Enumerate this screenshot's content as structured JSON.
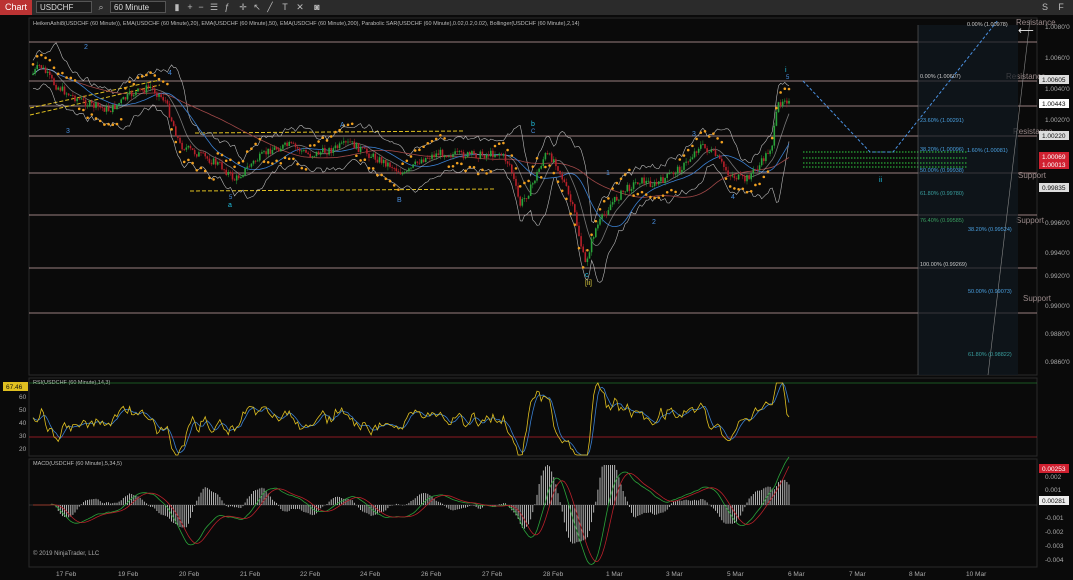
{
  "toolbar": {
    "tab_label": "Chart",
    "instrument": "USDCHF",
    "timeframe": "60 Minute"
  },
  "price_panel": {
    "indicators_title": "HeikenAshi8(USDCHF (60 Minute)), EMA(USDCHF (60 Minute),20), EMA(USDCHF (60 Minute),50), EMA(USDCHF (60 Minute),200), Parabolic SAR(USDCHF (60 Minute),0.02,0.2,0.02), Bollinger(USDCHF (60 Minute),2,14)",
    "price_ticks": [
      "1.0080'0",
      "1.0060'0",
      "1.0040'0",
      "1.0020'0",
      "0.9960'0",
      "0.9940'0",
      "0.9920'0",
      "0.9900'0",
      "0.9880'0",
      "0.9860'0"
    ],
    "price_badges": [
      {
        "text": "1.00605",
        "kind": "level"
      },
      {
        "text": "1.00443",
        "kind": "current"
      },
      {
        "text": "1.00220",
        "kind": "level"
      },
      {
        "text": "1.00069",
        "kind": "red"
      },
      {
        "text": "1.00013",
        "kind": "red"
      },
      {
        "text": "0.99835",
        "kind": "level"
      }
    ],
    "h_labels": [
      "Resistance",
      "Resistance",
      "Resistance",
      "Support",
      "Support",
      "Support"
    ],
    "fib_labels": [
      "0.00% (1.00978)",
      "0.00% (1.00607)",
      "23.60% (1.00291)",
      "38.20% (1.00096)",
      "50.00% (0.99938)",
      "61.80% (0.99780)",
      "76.40% (0.99585)",
      "100.00% (0.99269)",
      "1.60% (1.00081)",
      "38.20% (0.99524)",
      "50.00% (0.99073)",
      "61.80% (0.98822)"
    ],
    "wave_labels": [
      "2",
      "3",
      "4",
      "a",
      "5",
      "A",
      "B",
      "b",
      "C",
      "c",
      "[ii]",
      "1",
      "2",
      "3",
      "4",
      "5",
      "i",
      "ii"
    ],
    "copyright": "© 2019 NinjaTrader, LLC"
  },
  "rsi_panel": {
    "title": "RSI(USDCHF (60 Minute),14,3)",
    "current": "67.46",
    "ticks": [
      "60",
      "50",
      "40",
      "30",
      "20"
    ]
  },
  "macd_panel": {
    "title": "MACD(USDCHF (60 Minute),5,34,5)",
    "current_values": [
      "0.00253",
      "0.00281"
    ],
    "ticks": [
      "0.002",
      "0.001",
      "-0.001",
      "-0.002",
      "-0.003",
      "-0.004"
    ]
  },
  "date_axis": [
    "17 Feb",
    "19 Feb",
    "20 Feb",
    "21 Feb",
    "22 Feb",
    "24 Feb",
    "26 Feb",
    "27 Feb",
    "28 Feb",
    "1 Mar",
    "3 Mar",
    "5 Mar",
    "6 Mar",
    "7 Mar",
    "8 Mar",
    "10 Mar"
  ],
  "colors": {
    "background": "#0a0a0a",
    "bull_candle": "#2aa33a",
    "bear_candle": "#b8202a",
    "sar": "#f0a020",
    "ema_fast": "#3a7fd0",
    "resistance_line": "#c9a5a5",
    "fib": "#4aa0e0",
    "projection": "#4a90e0",
    "rsi_line": "#e0c020"
  }
}
